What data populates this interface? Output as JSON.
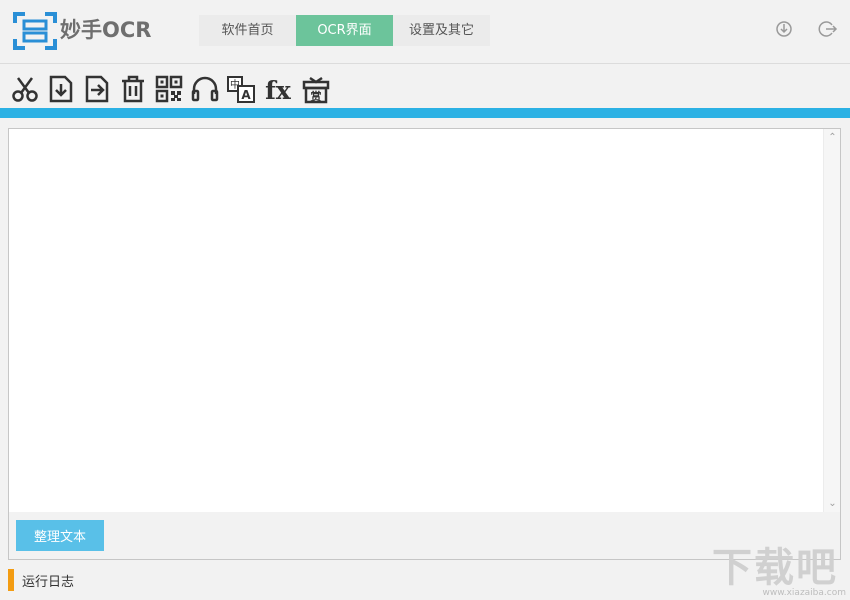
{
  "app": {
    "title": "妙手OCR"
  },
  "nav": {
    "tabs": [
      {
        "label": "软件首页",
        "active": false
      },
      {
        "label": "OCR界面",
        "active": true
      },
      {
        "label": "设置及其它",
        "active": false
      }
    ]
  },
  "window_controls": {
    "icons": [
      "download-icon",
      "exit-icon"
    ]
  },
  "toolbar": {
    "tools": [
      {
        "icon": "scissors-icon"
      },
      {
        "icon": "import-file-icon"
      },
      {
        "icon": "export-file-icon"
      },
      {
        "icon": "trash-icon"
      },
      {
        "icon": "qr-code-icon"
      },
      {
        "icon": "headphones-icon"
      },
      {
        "icon": "translate-icon"
      },
      {
        "icon": "formula-fx-icon",
        "glyph": "fx"
      },
      {
        "icon": "reward-gift-icon",
        "glyph": "赏"
      }
    ]
  },
  "editor": {
    "value": "",
    "tidy_label": "整理文本"
  },
  "log": {
    "title": "运行日志"
  },
  "watermark": {
    "text": "下载吧",
    "url": "www.xiazaiba.com"
  },
  "colors": {
    "accent_blue": "#2cb1e4",
    "active_tab": "#6cc49b",
    "button_blue": "#59c0e8",
    "log_marker": "#f39c12",
    "logo_blue": "#2a8fd6"
  }
}
